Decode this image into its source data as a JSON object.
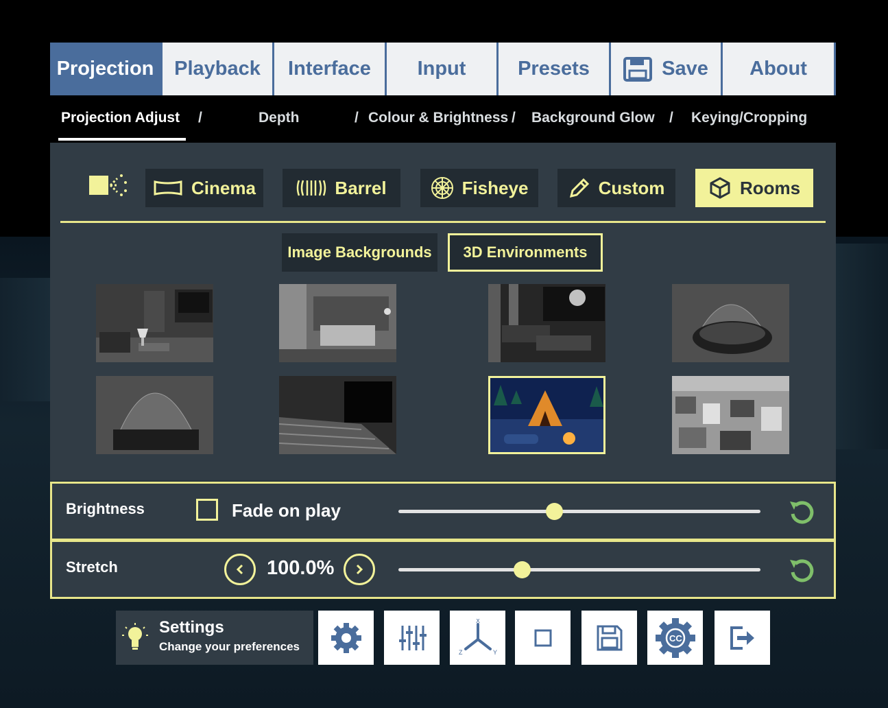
{
  "colors": {
    "accent": "#f2f29a",
    "tab_active": "#4a6d9c",
    "panel": "#313c45",
    "button_dark": "#222b32"
  },
  "tabs": [
    {
      "label": "Projection",
      "active": true
    },
    {
      "label": "Playback",
      "active": false
    },
    {
      "label": "Interface",
      "active": false
    },
    {
      "label": "Input",
      "active": false
    },
    {
      "label": "Presets",
      "active": false
    },
    {
      "label": "Save",
      "active": false,
      "icon": "floppy-disk-icon"
    },
    {
      "label": "About",
      "active": false
    }
  ],
  "subnav": {
    "items": [
      "Projection Adjust",
      "Depth",
      "Colour & Brightness",
      "Background Glow",
      "Keying/Cropping"
    ],
    "separator": "/",
    "active": "Projection Adjust"
  },
  "projection_modes": {
    "icon": "projector-icon",
    "items": [
      {
        "label": "Cinema",
        "icon": "screen-icon",
        "active": false
      },
      {
        "label": "Barrel",
        "icon": "barrel-icon",
        "active": false
      },
      {
        "label": "Fisheye",
        "icon": "fisheye-icon",
        "active": false
      },
      {
        "label": "Custom",
        "icon": "pencil-icon",
        "active": false
      },
      {
        "label": "Rooms",
        "icon": "cube-icon",
        "active": true
      }
    ]
  },
  "room_tabs": [
    {
      "label": "Image Backgrounds",
      "active": false
    },
    {
      "label": "3D Environments",
      "active": true
    }
  ],
  "rooms": [
    {
      "name": "living-room",
      "selected": false
    },
    {
      "name": "bedroom",
      "selected": false
    },
    {
      "name": "home-theater",
      "selected": false
    },
    {
      "name": "dome-cutaway",
      "selected": false
    },
    {
      "name": "dome",
      "selected": false
    },
    {
      "name": "cinema-hall",
      "selected": false
    },
    {
      "name": "campfire",
      "selected": true
    },
    {
      "name": "city",
      "selected": false
    }
  ],
  "brightness": {
    "label": "Brightness",
    "fade_label": "Fade on play",
    "fade_checked": false,
    "slider_value": 0.43
  },
  "stretch": {
    "label": "Stretch",
    "value": "100.0%",
    "slider_value": 0.34
  },
  "settings_card": {
    "title": "Settings",
    "subtitle": "Change your preferences",
    "icon": "lightbulb-icon"
  },
  "bottom_buttons": [
    "gear-icon",
    "sliders-icon",
    "axes-icon",
    "square-icon",
    "floppy-disk-icon",
    "cc-gear-icon",
    "exit-icon"
  ]
}
